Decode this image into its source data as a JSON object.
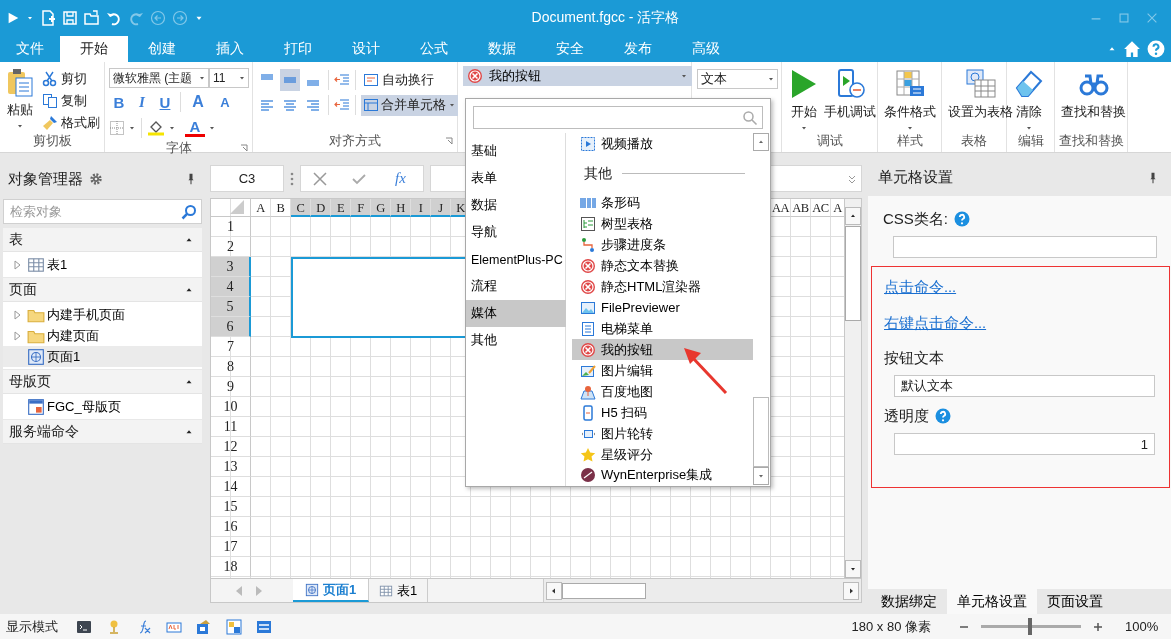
{
  "window": {
    "title": "Document.fgcc - 活字格"
  },
  "menu_tabs": [
    {
      "label": "文件",
      "selected": false
    },
    {
      "label": "开始",
      "selected": true
    },
    {
      "label": "创建",
      "selected": false
    },
    {
      "label": "插入",
      "selected": false
    },
    {
      "label": "打印",
      "selected": false
    },
    {
      "label": "设计",
      "selected": false
    },
    {
      "label": "公式",
      "selected": false
    },
    {
      "label": "数据",
      "selected": false
    },
    {
      "label": "安全",
      "selected": false
    },
    {
      "label": "发布",
      "selected": false
    },
    {
      "label": "高级",
      "selected": false
    }
  ],
  "ribbon": {
    "clipboard": {
      "label": "剪切板",
      "paste": "粘贴",
      "actions": [
        "剪切",
        "复制",
        "格式刷"
      ]
    },
    "font": {
      "label": "字体",
      "family": "微软雅黑 (主题",
      "size": "11",
      "styles": [
        "B",
        "I",
        "U"
      ],
      "resize": [
        "A",
        "A"
      ],
      "color_glyph": "A"
    },
    "alignment": {
      "label": "对齐方式",
      "buttons": [
        {
          "selected": false
        },
        {
          "selected": true
        },
        {
          "selected": false
        },
        {
          "selected": false
        },
        {
          "selected": false
        },
        {
          "selected": false
        }
      ],
      "wrap": "自动换行",
      "merge": {
        "label": "合并单元格",
        "selected": true
      }
    },
    "cell_type": {
      "value": "我的按钮"
    },
    "text_type": {
      "value": "文本"
    },
    "groups": [
      {
        "label": "调试",
        "buttons": [
          {
            "label": "开始",
            "menu": true
          },
          {
            "label": "手机调试",
            "menu": false
          }
        ]
      },
      {
        "label": "样式",
        "buttons": [
          {
            "label": "条件格式",
            "menu": true
          }
        ]
      },
      {
        "label": "表格",
        "buttons": [
          {
            "label": "设置为表格",
            "menu": false
          }
        ]
      },
      {
        "label": "编辑",
        "buttons": [
          {
            "label": "清除",
            "menu": true
          }
        ]
      },
      {
        "label": "查找和替换",
        "buttons": [
          {
            "label": "查找和替换",
            "menu": false
          }
        ]
      }
    ]
  },
  "explorer": {
    "title": "对象管理器",
    "search": {
      "placeholder": "检索对象"
    },
    "sections": [
      {
        "label": "表",
        "expanded": true,
        "items": [
          {
            "label": "表1",
            "kind": "table",
            "expandable": true,
            "selected": false
          }
        ]
      },
      {
        "label": "页面",
        "expanded": true,
        "items": [
          {
            "label": "内建手机页面",
            "kind": "folder",
            "expandable": true,
            "selected": false
          },
          {
            "label": "内建页面",
            "kind": "folder",
            "expandable": true,
            "selected": false
          },
          {
            "label": "页面1",
            "kind": "page",
            "expandable": false,
            "selected": true
          }
        ]
      },
      {
        "label": "母版页",
        "expanded": true,
        "items": [
          {
            "label": "FGC_母版页",
            "kind": "master",
            "expandable": false,
            "selected": false
          }
        ]
      },
      {
        "label": "服务端命令",
        "expanded": true
      }
    ]
  },
  "formula_bar": {
    "cell": "C3",
    "function_button": "fx"
  },
  "sheet": {
    "columns": [
      {
        "label": "A",
        "selected": false
      },
      {
        "label": "B",
        "selected": false
      },
      {
        "label": "C",
        "selected": true
      },
      {
        "label": "D",
        "selected": true
      },
      {
        "label": "E",
        "selected": true
      },
      {
        "label": "F",
        "selected": true
      },
      {
        "label": "G",
        "selected": true
      },
      {
        "label": "H",
        "selected": true
      },
      {
        "label": "I",
        "selected": true
      },
      {
        "label": "J",
        "selected": true
      },
      {
        "label": "K",
        "selected": true
      }
    ],
    "columns_far": [
      {
        "label": "AA",
        "selected": false
      },
      {
        "label": "AB",
        "selected": false
      },
      {
        "label": "AC",
        "selected": false
      },
      {
        "label": "A",
        "selected": false
      }
    ],
    "rows": [
      {
        "label": "1",
        "selected": false
      },
      {
        "label": "2",
        "selected": false
      },
      {
        "label": "3",
        "selected": true
      },
      {
        "label": "4",
        "selected": true
      },
      {
        "label": "5",
        "selected": true
      },
      {
        "label": "6",
        "selected": true
      },
      {
        "label": "7",
        "selected": false
      },
      {
        "label": "8",
        "selected": false
      },
      {
        "label": "9",
        "selected": false
      },
      {
        "label": "10",
        "selected": false
      },
      {
        "label": "11",
        "selected": false
      },
      {
        "label": "12",
        "selected": false
      },
      {
        "label": "13",
        "selected": false
      },
      {
        "label": "14",
        "selected": false
      },
      {
        "label": "15",
        "selected": false
      },
      {
        "label": "16",
        "selected": false
      },
      {
        "label": "17",
        "selected": false
      },
      {
        "label": "18",
        "selected": false
      }
    ],
    "tabs": [
      {
        "label": "页面1",
        "kind": "page",
        "selected": true
      },
      {
        "label": "表1",
        "kind": "table",
        "selected": false
      }
    ]
  },
  "picker": {
    "categories": [
      {
        "label": "基础",
        "selected": false
      },
      {
        "label": "表单",
        "selected": false
      },
      {
        "label": "数据",
        "selected": false
      },
      {
        "label": "导航",
        "selected": false
      },
      {
        "label": "ElementPlus-PC",
        "selected": false
      },
      {
        "label": "流程",
        "selected": false
      },
      {
        "label": "媒体",
        "selected": true
      },
      {
        "label": "其他",
        "selected": false
      }
    ],
    "top_items": [
      {
        "label": "视频播放",
        "selected": false
      }
    ],
    "section": "其他",
    "items": [
      {
        "label": "条形码",
        "selected": false
      },
      {
        "label": "树型表格",
        "selected": false
      },
      {
        "label": "步骤进度条",
        "selected": false
      },
      {
        "label": "静态文本替换",
        "selected": false
      },
      {
        "label": "静态HTML渲染器",
        "selected": false
      },
      {
        "label": "FilePreviewer",
        "selected": false
      },
      {
        "label": "电梯菜单",
        "selected": false
      },
      {
        "label": "我的按钮",
        "selected": true
      },
      {
        "label": "图片编辑",
        "selected": false
      },
      {
        "label": "百度地图",
        "selected": false
      },
      {
        "label": "H5 扫码",
        "selected": false
      },
      {
        "label": "图片轮转",
        "selected": false
      },
      {
        "label": "星级评分",
        "selected": false
      },
      {
        "label": "WynEnterprise集成",
        "selected": false
      }
    ]
  },
  "properties": {
    "title": "单元格设置",
    "css_label": "CSS类名:",
    "links": [
      "点击命令...",
      "右键点击命令..."
    ],
    "fields": [
      {
        "label": "按钮文本",
        "value": "默认文本",
        "help": false,
        "right_aligned": false
      },
      {
        "label": "透明度",
        "value": "1",
        "help": true,
        "right_aligned": true
      }
    ],
    "tabs": [
      {
        "label": "数据绑定",
        "selected": false
      },
      {
        "label": "单元格设置",
        "selected": true
      },
      {
        "label": "页面设置",
        "selected": false
      }
    ]
  },
  "status_bar": {
    "mode": "显示模式",
    "size": "180 x 80 像素",
    "zoom": {
      "level": 0.49,
      "reading": "100%"
    }
  }
}
